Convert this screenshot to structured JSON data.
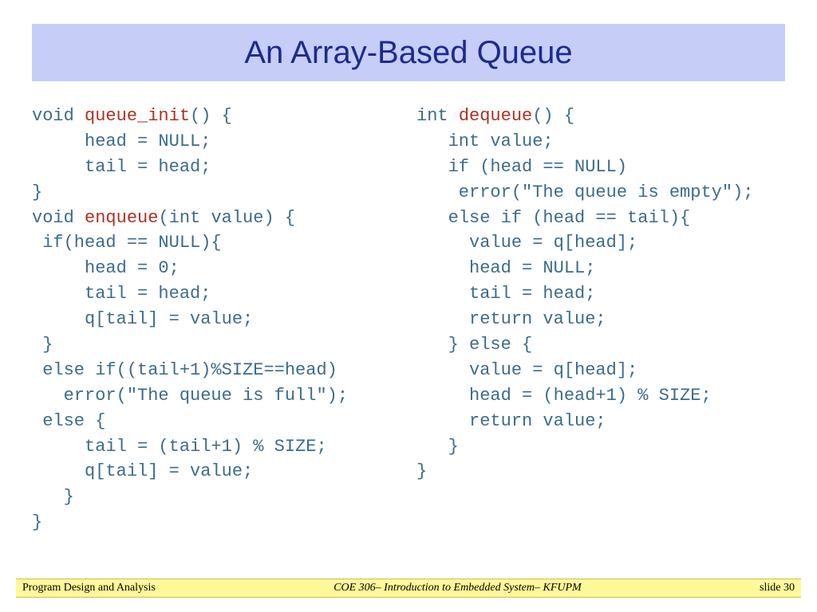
{
  "title": "An Array-Based Queue",
  "code": {
    "left": {
      "init_ret": "void",
      "init_name": "queue_init",
      "init_sig_tail": "() {",
      "init_body1": "     head = NULL;",
      "init_body2": "     tail = head;",
      "init_close": "}",
      "enq_ret": "void",
      "enq_name": "enqueue",
      "enq_sig_tail": "(int value) {",
      "enq_l1": " if(head == NULL){",
      "enq_l2": "     head = 0;",
      "enq_l3": "     tail = head;",
      "enq_l4": "     q[tail] = value;",
      "enq_l5": " }",
      "enq_l6": " else if((tail+1)%SIZE==head)",
      "enq_l7": "   error(\"The queue is full\");",
      "enq_l8": " else {",
      "enq_l9": "     tail = (tail+1) % SIZE;",
      "enq_l10": "     q[tail] = value;",
      "enq_l11": "   }",
      "enq_l12": "}"
    },
    "right": {
      "deq_ret": "int",
      "deq_name": "dequeue",
      "deq_sig_tail": "() {",
      "d1": "   int value;",
      "d2": "   if (head == NULL)",
      "d3": "    error(\"The queue is empty\");",
      "d4": "   else if (head == tail){",
      "d5": "     value = q[head];",
      "d6": "     head = NULL;",
      "d7": "     tail = head;",
      "d8": "     return value;",
      "d9": "   } else {",
      "d10": "     value = q[head];",
      "d11": "     head = (head+1) % SIZE;",
      "d12": "     return value;",
      "d13": "   }",
      "d14": "}"
    }
  },
  "footer": {
    "left": "Program Design and Analysis",
    "center": "COE 306– Introduction to Embedded System– KFUPM",
    "right": "slide 30"
  }
}
